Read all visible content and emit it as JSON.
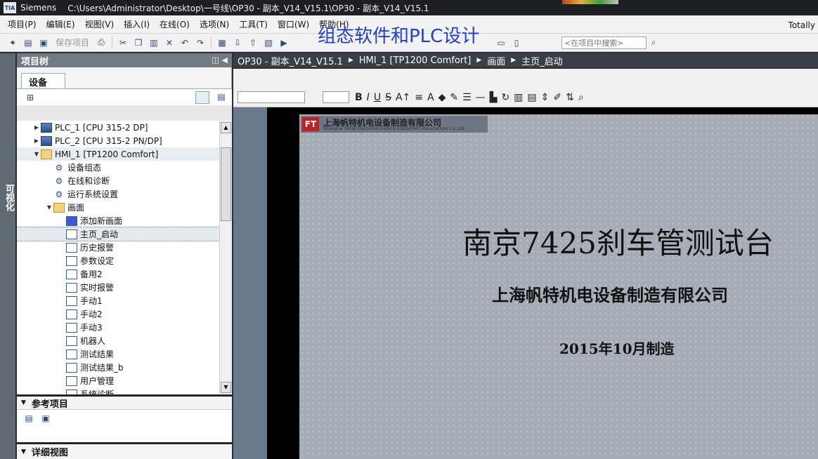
{
  "title_bar": {
    "logo": "TIA",
    "app": "Siemens",
    "path": "C:\\Users\\Administrator\\Desktop\\一号线\\OP30 - 副本_V14_V15.1\\OP30 - 副本_V14_V15.1"
  },
  "menu": {
    "items": [
      "项目(P)",
      "编辑(E)",
      "视图(V)",
      "插入(I)",
      "在线(O)",
      "选项(N)",
      "工具(T)",
      "窗口(W)",
      "帮助(H)"
    ],
    "right_label": "Totally"
  },
  "watermark": "组态软件和PLC设计",
  "toolbar": {
    "save_label": "保存项目",
    "search_placeholder": "<在项目中搜索>"
  },
  "left_tab": "可视化",
  "project_tree": {
    "header": "项目树",
    "tab": "设备",
    "items": [
      {
        "label": "PLC_1 [CPU 315-2 DP]",
        "level": 1,
        "toggle": "▶",
        "icon": "plc"
      },
      {
        "label": "PLC_2 [CPU 315-2 PN/DP]",
        "level": 1,
        "toggle": "▶",
        "icon": "plc"
      },
      {
        "label": "HMI_1 [TP1200 Comfort]",
        "level": 1,
        "toggle": "▼",
        "icon": "folder"
      },
      {
        "label": "设备组态",
        "level": 2,
        "toggle": "",
        "icon": "tool"
      },
      {
        "label": "在线和诊断",
        "level": 2,
        "toggle": "",
        "icon": "tool"
      },
      {
        "label": "运行系统设置",
        "level": 2,
        "toggle": "",
        "icon": "tool"
      },
      {
        "label": "画面",
        "level": 2,
        "toggle": "▼",
        "icon": "folder"
      },
      {
        "label": "添加新画面",
        "level": 3,
        "toggle": "",
        "icon": "add"
      },
      {
        "label": "主页_启动",
        "level": 3,
        "toggle": "",
        "icon": "screen",
        "selected": true
      },
      {
        "label": "历史报警",
        "level": 3,
        "toggle": "",
        "icon": "screen"
      },
      {
        "label": "参数设定",
        "level": 3,
        "toggle": "",
        "icon": "screen"
      },
      {
        "label": "备用2",
        "level": 3,
        "toggle": "",
        "icon": "screen"
      },
      {
        "label": "实时报警",
        "level": 3,
        "toggle": "",
        "icon": "screen"
      },
      {
        "label": "手动1",
        "level": 3,
        "toggle": "",
        "icon": "screen"
      },
      {
        "label": "手动2",
        "level": 3,
        "toggle": "",
        "icon": "screen"
      },
      {
        "label": "手动3",
        "level": 3,
        "toggle": "",
        "icon": "screen"
      },
      {
        "label": "机器人",
        "level": 3,
        "toggle": "",
        "icon": "screen"
      },
      {
        "label": "测试结果",
        "level": 3,
        "toggle": "",
        "icon": "screen"
      },
      {
        "label": "测试结果_b",
        "level": 3,
        "toggle": "",
        "icon": "screen"
      },
      {
        "label": "用户管理",
        "level": 3,
        "toggle": "",
        "icon": "screen"
      },
      {
        "label": "系统诊断",
        "level": 3,
        "toggle": "",
        "icon": "screen"
      }
    ]
  },
  "reference_projects": {
    "header": "参考项目"
  },
  "detail_view": {
    "header": "详细视图"
  },
  "breadcrumb": [
    "OP30 - 副本_V14_V15.1",
    "HMI_1 [TP1200 Comfort]",
    "画面",
    "主页_启动"
  ],
  "hmi_screen": {
    "banner_logo": "FT",
    "banner_cn": "上海帆特机电设备制造有限公司",
    "banner_en": "Shanghai Fante Electromechanical Equipment Manufacture Co.,Ltd",
    "title": "南京7425刹车管测试台",
    "company": "上海帆特机电设备制造有限公司",
    "date": "2015年10月制造"
  },
  "colors": {
    "breadcrumb_bg": "#383f46",
    "tree_header_bg": "#737b82",
    "hmi_screen_bg": "#a8acb6",
    "watermark": "#1f3fd2"
  }
}
